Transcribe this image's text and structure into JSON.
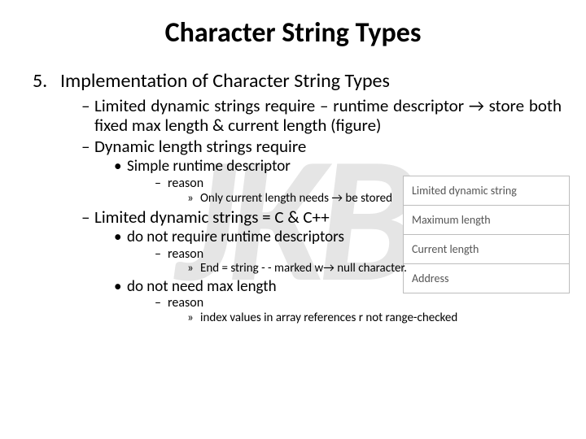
{
  "watermark": "JKB",
  "title": "Character String Types",
  "list_number": "5.",
  "heading": "Implementation of Character String Types",
  "l1a": "Limited dynamic strings require – runtime descriptor → store both fixed max length & current length (figure)",
  "l1b": "Dynamic length strings require",
  "l2a": "Simple runtime descriptor",
  "l3a": "reason",
  "l4a": "Only current length needs → be stored",
  "l1c": "Limited dynamic strings = C & C++",
  "l2b": "do not require runtime descriptors",
  "l3b": "reason",
  "l4b": "End = string - - marked w→ null character.",
  "l2c": "do not need max length",
  "l3c": "reason",
  "l4c": "index values in array references r not range-checked",
  "figure": {
    "r1": "Limited dynamic string",
    "r2": "Maximum length",
    "r3": "Current length",
    "r4": "Address"
  }
}
